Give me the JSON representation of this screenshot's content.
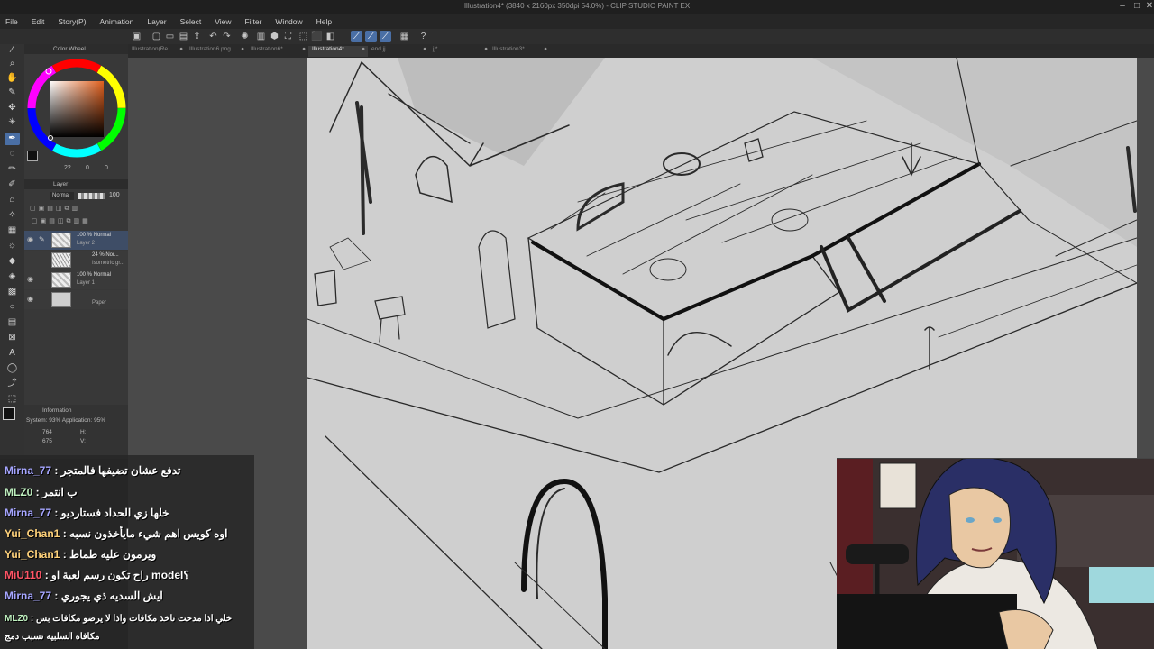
{
  "window": {
    "title": "Illustration4* (3840 x 2160px 350dpi 54.0%) - CLIP STUDIO PAINT EX"
  },
  "menu": [
    "File",
    "Edit",
    "Story(P)",
    "Animation",
    "Layer",
    "Select",
    "View",
    "Filter",
    "Window",
    "Help"
  ],
  "tabs": [
    {
      "label": "Illustration(Re..."
    },
    {
      "label": "Illustration6.png"
    },
    {
      "label": "Illustration6*"
    },
    {
      "label": "Illustration4*",
      "active": true
    },
    {
      "label": "end.jj"
    },
    {
      "label": "jj*"
    },
    {
      "label": "Illustration3*"
    }
  ],
  "color_wheel": {
    "title": "Color Wheel",
    "values": [
      "22",
      "0",
      "0"
    ]
  },
  "layer_panel": {
    "title": "Layer",
    "blend": "Normal",
    "opacity": "100",
    "layers": [
      {
        "line1": "100 % Normal",
        "line2": "Layer 2",
        "selected": true
      },
      {
        "line1": "24 % Nor...",
        "line2": "Isometric gr..."
      },
      {
        "line1": "100 % Normal",
        "line2": "Layer 1"
      },
      {
        "line1": "",
        "line2": "Paper"
      }
    ]
  },
  "info": {
    "title": "Information",
    "system": "System: 93% Application: 95%",
    "x": "764",
    "y": "675",
    "h": "H:",
    "v": "V:"
  },
  "chat": [
    {
      "user": "Mirna_77",
      "msg": "تدفع عشان تضيفها فالمتجر"
    },
    {
      "user": "MLZ0",
      "msg": "ب انتمر"
    },
    {
      "user": "Mirna_77",
      "msg": "خلها زي الحداد فستارديو"
    },
    {
      "user": "Yui_Chan1",
      "msg": "اوه كويس اهم شيء مايأخذون نسبه"
    },
    {
      "user": "Yui_Chan1",
      "msg": "ويرمون عليه طماط"
    },
    {
      "user": "MiU110",
      "msg": "راح تكون رسم لعبة او model؟"
    },
    {
      "user": "Mirna_77",
      "msg": "ايش السديه ذي يجوري"
    },
    {
      "user": "MLZ0",
      "msg": "خلي اذا مدحت تاخذ مكافات واذا لا يرضو مكافات بس"
    },
    {
      "user": "",
      "msg": "مكافاه السلبيه تسبب دمج"
    }
  ],
  "colors": {
    "accent": "#4a6fa5",
    "chat_user": "#a5a5ff"
  }
}
